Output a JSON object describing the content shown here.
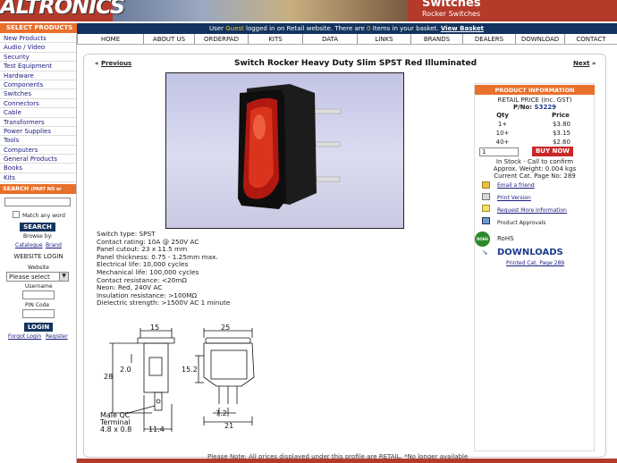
{
  "header": {
    "logo": "ALTRONICS",
    "section_title": "Switches",
    "section_subtitle": "Rocker Switches"
  },
  "userbar": {
    "pre": "User",
    "user": "Guest",
    "mid": "logged in on Retail website. There are",
    "count": "0",
    "post": "Items in your basket.",
    "link": "View Basket"
  },
  "nav": [
    "HOME",
    "ABOUT US",
    "ORDERPAD",
    "KITS",
    "DATA",
    "LINKS",
    "BRANDS",
    "DEALERS",
    "DOWNLOAD",
    "CONTACT"
  ],
  "sidebar": {
    "heading": "SELECT PRODUCTS",
    "categories": [
      "New Products",
      "Audio / Video",
      "Security",
      "Test Equipment",
      "Hardware",
      "Components",
      "Switches",
      "Connectors",
      "Cable",
      "Transformers",
      "Power Supplies",
      "Tools",
      "Computers",
      "General Products",
      "Books",
      "Kits"
    ],
    "search_heading": "SEARCH",
    "search_hint": "(PART NO or DESC)",
    "match_any": "Match any word",
    "search_button": "SEARCH",
    "browse_by": "Browse by:",
    "browse_catalogue": "Catalogue",
    "browse_brand": "Brand",
    "login_heading": "WEBSITE LOGIN",
    "website_label": "Website",
    "website_value": "Please select",
    "username_label": "Username",
    "pin_label": "PIN Code",
    "login_button": "LOGIN",
    "forgot": "Forgot Login",
    "register": "Register"
  },
  "product": {
    "prev": "Previous",
    "next": "Next",
    "title": "Switch Rocker Heavy Duty Slim SPST Red Illuminated",
    "specs": [
      "Switch type: SPST",
      "Contact rating: 10A @ 250V AC",
      "Panel cutout: 23 x 11.5 mm",
      "Panel thickness: 0.75 - 1.25mm max.",
      "Electrical life: 10,000 cycles",
      "Mechanical life: 100,000 cycles",
      "Contact resistance: <20mΩ",
      "Neon: Red, 240V AC",
      "Insulation resistance: >100MΩ",
      "Dielectric strength: >1500V AC 1 minute"
    ],
    "drawing_labels": {
      "w_top": "15",
      "w_side": "25",
      "h_left": "28",
      "h_small": "2.0",
      "h_right": "15.2",
      "pins": "7.2",
      "base": "21",
      "depth": "11.4",
      "terminal_1": "Male QC",
      "terminal_2": "Terminal",
      "terminal_3": "4.8 x 0.8"
    }
  },
  "info": {
    "heading": "PRODUCT INFORMATION",
    "retail": "RETAIL PRICE (Inc. GST)",
    "pno_label": "P/No:",
    "pno": "S3229",
    "qty_header": "Qty",
    "price_header": "Price",
    "rows": [
      {
        "qty": "1+",
        "price": "$3.80"
      },
      {
        "qty": "10+",
        "price": "$3.15"
      },
      {
        "qty": "40+",
        "price": "$2.60"
      }
    ],
    "qty_value": "1",
    "buy": "BUY NOW",
    "stock": "In Stock - Call to confirm",
    "weight": "Approx. Weight: 0.004 kgs",
    "catpage": "Current Cat. Page No: 289",
    "links": [
      "Email a friend",
      "Print Version",
      "Request More Information",
      "Product Approvals"
    ],
    "rohs_badge": "ROHS",
    "rohs": "RoHS",
    "downloads": "DOWNLOADS",
    "printed": "Printed Cat. Page 289"
  },
  "footer_note": "Please Note: All prices displayed under this profile are RETAIL. *No longer available"
}
